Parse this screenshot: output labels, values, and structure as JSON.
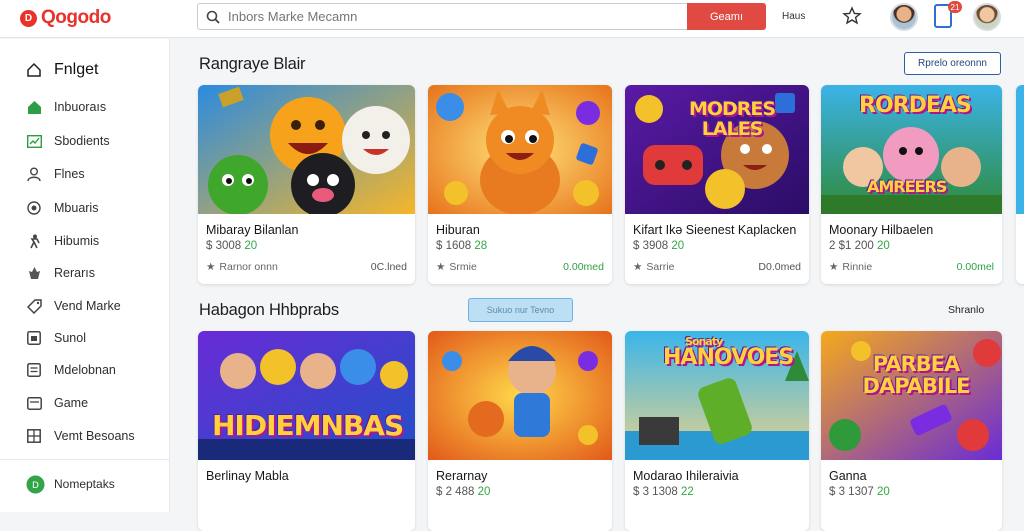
{
  "brand": {
    "name": "Qogodo",
    "mark": "D"
  },
  "search": {
    "placeholder": "Inbors Marke Mecamn",
    "button": "Geamı"
  },
  "header": {
    "link": "Haus",
    "notification_count": "21"
  },
  "sidebar": {
    "title": "Fnlget",
    "items": [
      {
        "label": "Inbuoraıs",
        "icon": "home-icon"
      },
      {
        "label": "Sbodients",
        "icon": "chart-icon"
      },
      {
        "label": "Flnes",
        "icon": "person-icon"
      },
      {
        "label": "Mbuaris",
        "icon": "target-icon"
      },
      {
        "label": "Hibumis",
        "icon": "runner-icon"
      },
      {
        "label": "Rerarıs",
        "icon": "fire-icon"
      },
      {
        "label": "Vend Marke",
        "icon": "tag-icon"
      },
      {
        "label": "Sunol",
        "icon": "box-icon"
      },
      {
        "label": "Mdelobnan",
        "icon": "list-icon"
      },
      {
        "label": "Game",
        "icon": "gamepad-icon"
      },
      {
        "label": "Vemt Besoans",
        "icon": "grid-icon"
      }
    ],
    "footer": {
      "label": "Nomeptaks",
      "icon": "badge-icon"
    }
  },
  "section1": {
    "title": "Rangraye Blair",
    "button": "Rprelo oreonnn"
  },
  "section2": {
    "title": "Habagon Hhbprabs",
    "pill": "Sukuo nur Tevno",
    "link": "Shranlo"
  },
  "cards_row1": [
    {
      "title": "Mibaray Bilanlan",
      "price_prefix": "$ 3008 ",
      "price_green": "20",
      "category": "Rarnor onnn",
      "status": "0C.lned",
      "status_green": false
    },
    {
      "title": "Hiburan",
      "price_prefix": "$ 1608 ",
      "price_green": "28",
      "category": "Srmie",
      "status": "0.00med",
      "status_green": true
    },
    {
      "title": "Kifart Ikə Sieenest Kaplacken",
      "price_prefix": "$ 3908 ",
      "price_green": "20",
      "category": "Sarrie",
      "status": "D0.0med",
      "status_green": false
    },
    {
      "title": "Moonary Hilbaelen",
      "price_prefix": "2 $1 200 ",
      "price_green": "20",
      "category": "Rinnie",
      "status": "0.00mel",
      "status_green": true
    }
  ],
  "cards_row2": [
    {
      "title": "Berlinay Mabla",
      "price_prefix": "",
      "price_green": ""
    },
    {
      "title": "Rerarnay",
      "price_prefix": "$ 2 488 ",
      "price_green": "20"
    },
    {
      "title": "Modarao Ihileraivia",
      "price_prefix": "$ 3 1308 ",
      "price_green": "22"
    },
    {
      "title": "Ganna",
      "price_prefix": "$ 3 1307 ",
      "price_green": "20"
    }
  ],
  "art_text": {
    "card2": "MODRES LALES",
    "card3": "RORDEAS",
    "card3_sub": "AMREERS",
    "card4": "HIDIEMNBAS",
    "card6": "HANOVOES",
    "card6_top": "Sonaty",
    "card7": "PARBEA DAPABILE"
  },
  "colors": {
    "accent": "#e04a43",
    "brand": "#e8322b",
    "green": "#35a547",
    "outline": "#2d5fa8"
  }
}
